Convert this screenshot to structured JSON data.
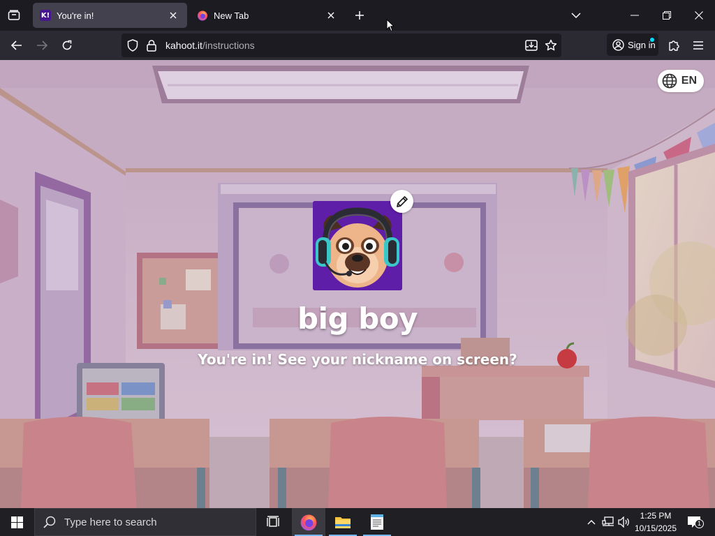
{
  "browser": {
    "tabs": [
      {
        "title": "You're in!",
        "favicon": "kahoot-icon",
        "active": true
      },
      {
        "title": "New Tab",
        "favicon": "firefox-icon",
        "active": false
      }
    ],
    "url": {
      "domain": "kahoot.it",
      "path": "/instructions"
    },
    "signin_label": "Sign in"
  },
  "page": {
    "language_label": "EN",
    "nickname": "big boy",
    "message": "You're in! See your nickname on screen?",
    "avatar": "pug-with-headset",
    "accent_color": "#5f1ea8"
  },
  "taskbar": {
    "search_placeholder": "Type here to search",
    "time": "1:25 PM",
    "date": "10/15/2025",
    "notification_count": "1"
  }
}
